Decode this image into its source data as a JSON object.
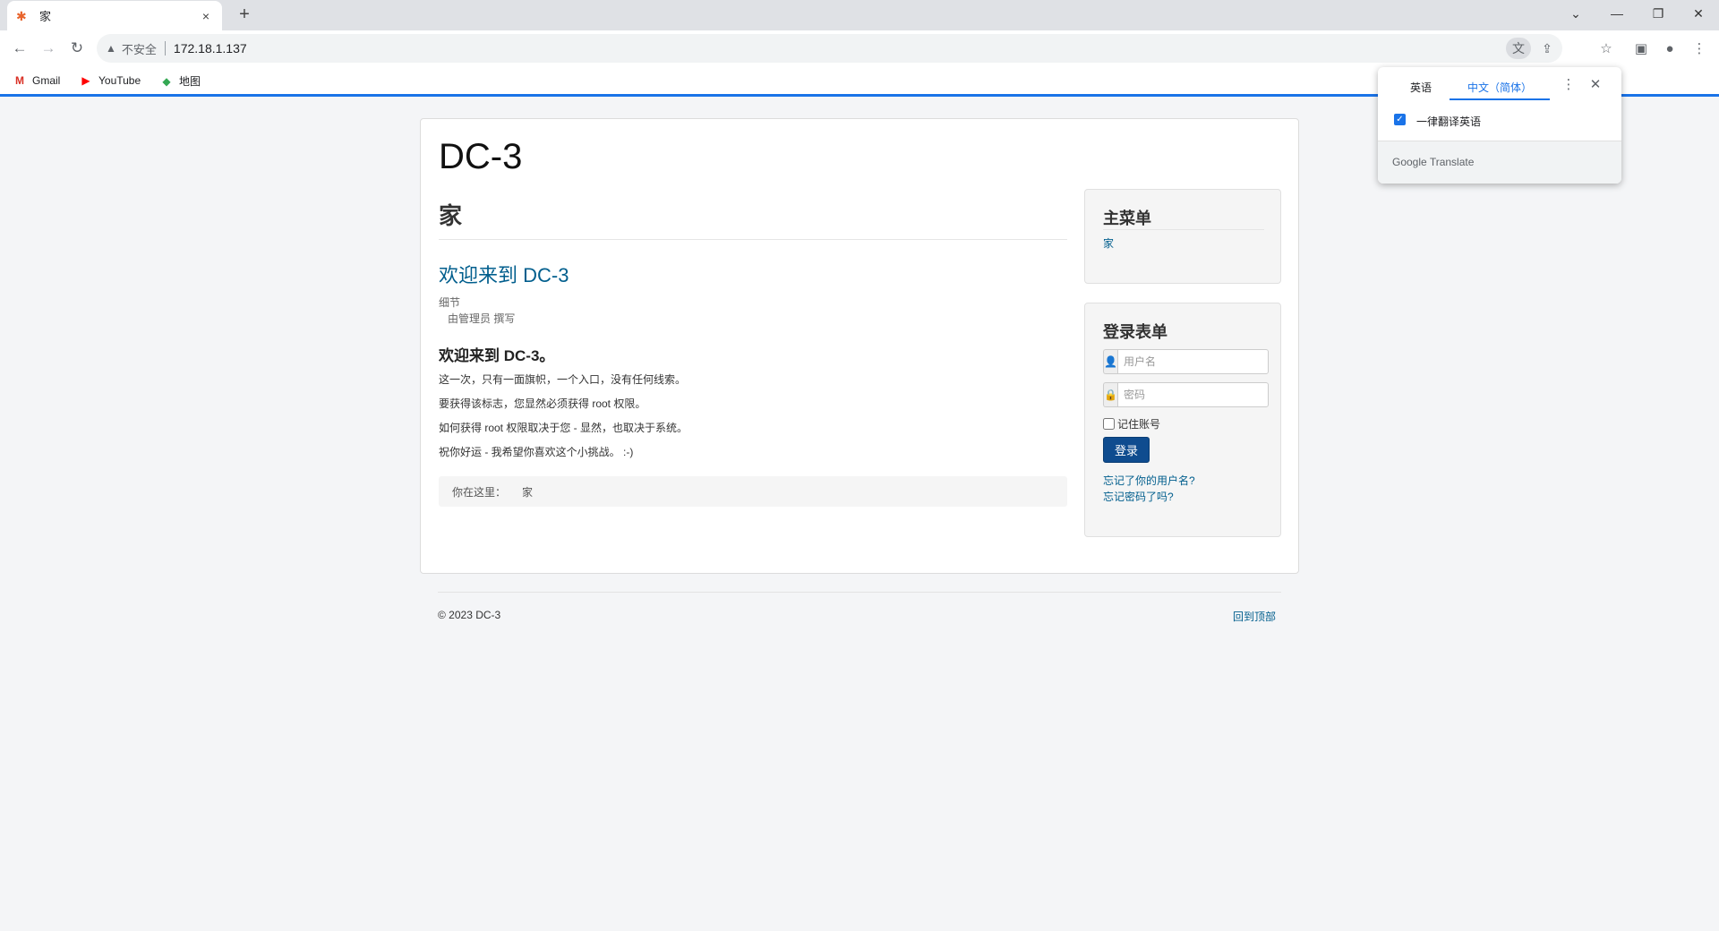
{
  "browser": {
    "tab_title": "家",
    "tab_close": "×",
    "new_tab": "+",
    "address_warning": "不安全",
    "url": "172.18.1.137",
    "bookmarks": [
      "Gmail",
      "YouTube",
      "地图"
    ]
  },
  "translate_popup": {
    "source_lang": "英语",
    "target_lang": "中文（简体）",
    "always_translate": "一律翻译英语",
    "brand": "Google Translate"
  },
  "page": {
    "site_title": "DC-3",
    "page_heading": "家",
    "article": {
      "title": "欢迎来到 DC-3",
      "details_label": "细节",
      "author": "由管理员 撰写",
      "subtitle": "欢迎来到 DC-3。",
      "paragraphs": [
        "这一次，只有一面旗帜，一个入口，没有任何线索。",
        "要获得该标志，您显然必须获得 root 权限。",
        "如何获得 root 权限取决于您 - 显然，也取决于系统。",
        "祝你好运 - 我希望你喜欢这个小挑战。 :-)"
      ]
    },
    "breadcrumb": {
      "label": "你在这里：",
      "item": "家"
    },
    "main_menu": {
      "title": "主菜单",
      "items": [
        "家"
      ]
    },
    "login_form": {
      "title": "登录表单",
      "username_placeholder": "用户名",
      "password_placeholder": "密码",
      "remember_label": "记住账号",
      "submit_label": "登录",
      "forgot_username": "忘记了你的用户名?",
      "forgot_password": "忘记密码了吗?"
    },
    "footer": {
      "copyright": "© 2023 DC-3",
      "back_to_top": "回到顶部"
    }
  },
  "colors": {
    "link": "#005e8d",
    "login_button": "#0f4c8f",
    "accent": "#1a73e8"
  }
}
